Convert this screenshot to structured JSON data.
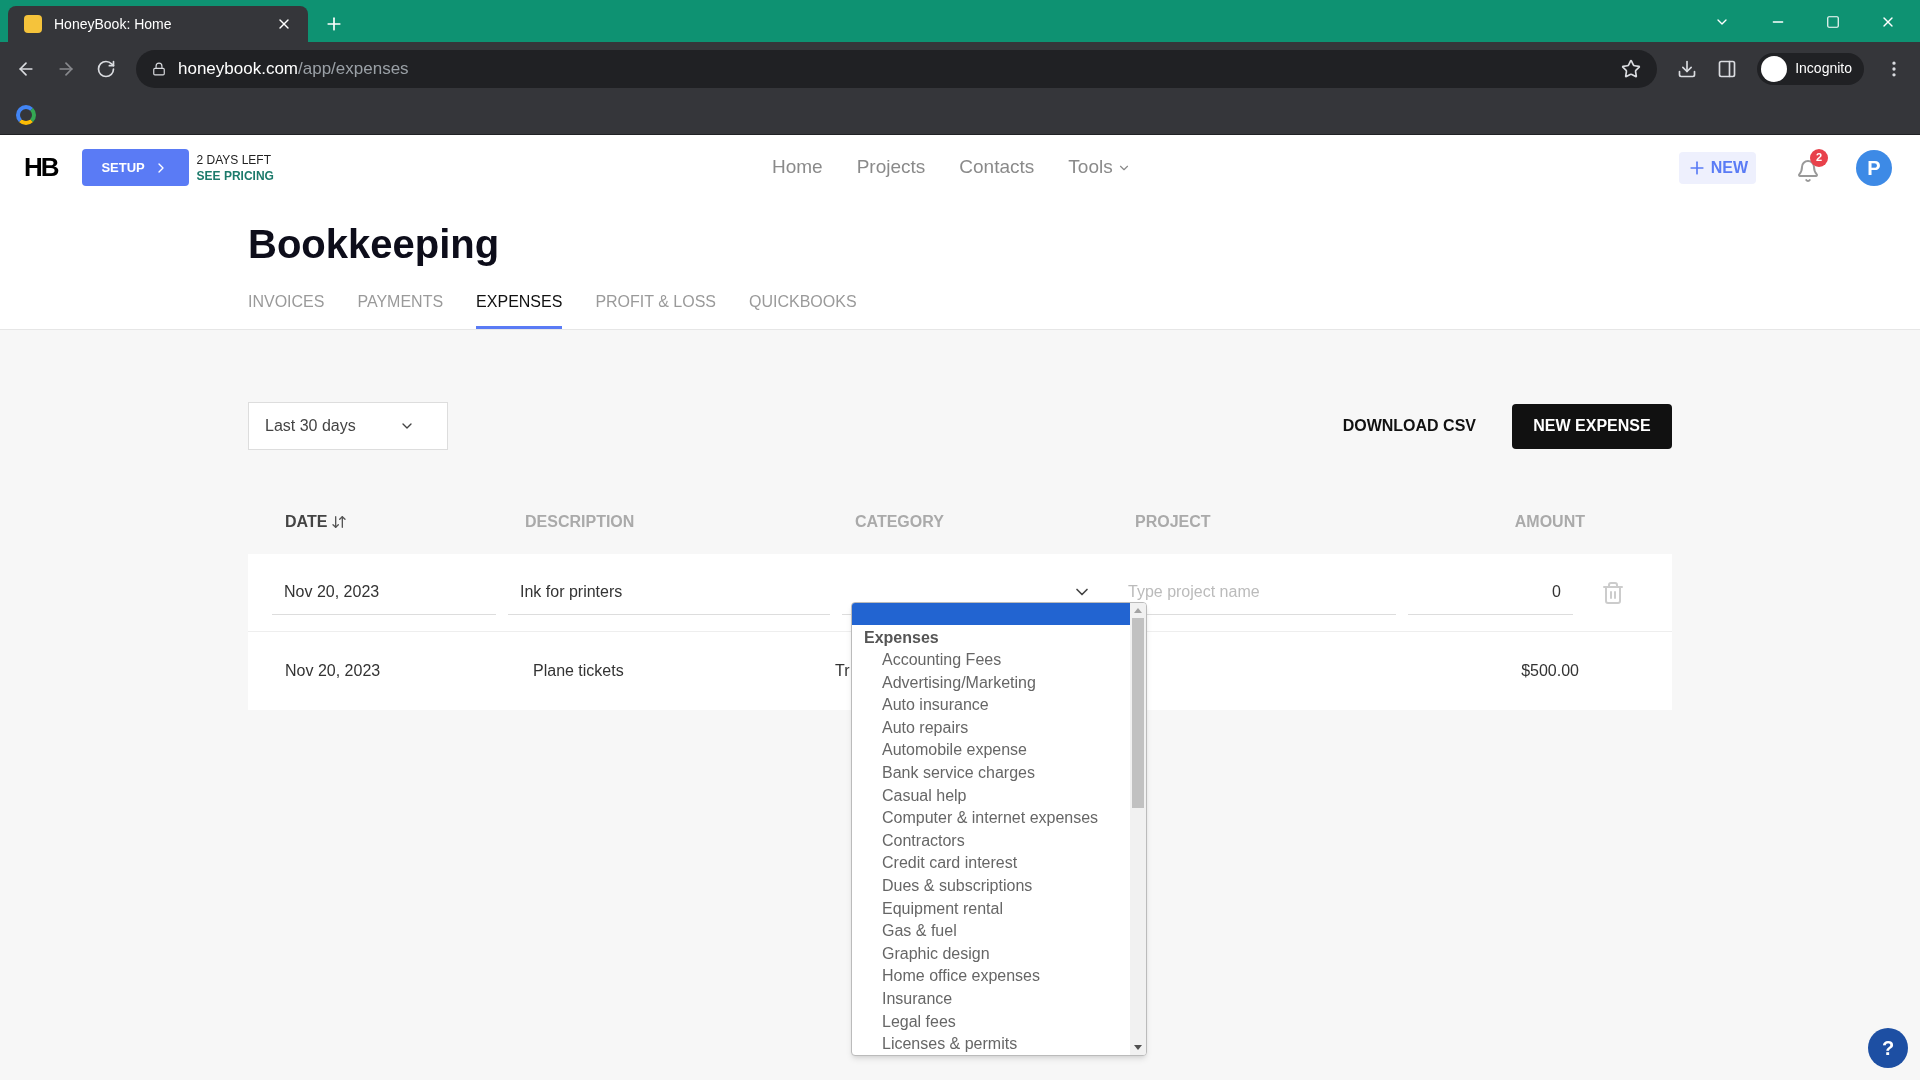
{
  "browser": {
    "tab_title": "HoneyBook: Home",
    "url_host": "honeybook.com",
    "url_path": "/app/expenses",
    "profile": "Incognito"
  },
  "header": {
    "logo": "HB",
    "setup": "SETUP",
    "trial": "2 DAYS LEFT",
    "pricing": "SEE PRICING",
    "nav": [
      "Home",
      "Projects",
      "Contacts",
      "Tools"
    ],
    "new": "NEW",
    "notifications": "2",
    "avatar": "P"
  },
  "page": {
    "title": "Bookkeeping",
    "tabs": [
      {
        "label": "INVOICES",
        "selected": false
      },
      {
        "label": "PAYMENTS",
        "selected": false
      },
      {
        "label": "EXPENSES",
        "selected": true
      },
      {
        "label": "PROFIT & LOSS",
        "selected": false
      },
      {
        "label": "QUICKBOOKS",
        "selected": false
      }
    ]
  },
  "toolbar": {
    "range": "Last 30 days",
    "download": "DOWNLOAD CSV",
    "new_expense": "NEW EXPENSE"
  },
  "table": {
    "columns": [
      {
        "label": "DATE",
        "sortable": true
      },
      {
        "label": "DESCRIPTION",
        "sortable": false
      },
      {
        "label": "CATEGORY",
        "sortable": false
      },
      {
        "label": "PROJECT",
        "sortable": false
      },
      {
        "label": "AMOUNT",
        "sortable": false
      }
    ],
    "edit_row": {
      "date": "Nov 20, 2023",
      "description": "Ink for printers",
      "project_placeholder": "Type project name",
      "amount": "0"
    },
    "rows": [
      {
        "date": "Nov 20, 2023",
        "description": "Plane tickets",
        "category": "Tr",
        "amount": "$500.00"
      }
    ]
  },
  "dropdown": {
    "blank_option_selected": true,
    "group": "Expenses",
    "options": [
      "Accounting Fees",
      "Advertising/Marketing",
      "Auto insurance",
      "Auto repairs",
      "Automobile expense",
      "Bank service charges",
      "Casual help",
      "Computer & internet expenses",
      "Contractors",
      "Credit card interest",
      "Dues & subscriptions",
      "Equipment rental",
      "Gas & fuel",
      "Graphic design",
      "Home office expenses",
      "Insurance",
      "Legal fees",
      "Licenses & permits"
    ]
  },
  "help": "?"
}
